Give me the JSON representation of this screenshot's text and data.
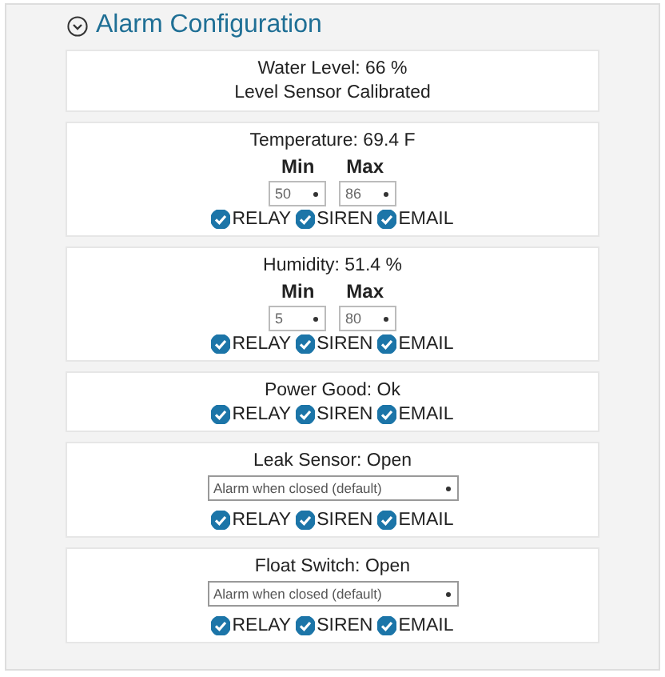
{
  "section": {
    "title": "Alarm Configuration",
    "expanded": true
  },
  "cards": [
    {
      "kind": "info",
      "lines": [
        "Water Level: 66 %",
        "Level Sensor Calibrated"
      ]
    },
    {
      "kind": "range",
      "lines": [
        "Temperature: 69.4 F"
      ],
      "min_label": "Min",
      "max_label": "Max",
      "min": "50",
      "max": "86",
      "options": [
        {
          "label": "RELAY",
          "checked": true
        },
        {
          "label": "SIREN",
          "checked": true
        },
        {
          "label": "EMAIL",
          "checked": true
        }
      ]
    },
    {
      "kind": "range",
      "lines": [
        "Humidity: 51.4 %"
      ],
      "min_label": "Min",
      "max_label": "Max",
      "min": "5",
      "max": "80",
      "options": [
        {
          "label": "RELAY",
          "checked": true
        },
        {
          "label": "SIREN",
          "checked": true
        },
        {
          "label": "EMAIL",
          "checked": true
        }
      ]
    },
    {
      "kind": "plain",
      "lines": [
        "Power Good: Ok"
      ],
      "options": [
        {
          "label": "RELAY",
          "checked": true
        },
        {
          "label": "SIREN",
          "checked": true
        },
        {
          "label": "EMAIL",
          "checked": true
        }
      ]
    },
    {
      "kind": "mode",
      "lines": [
        "Leak Sensor: Open"
      ],
      "mode": "Alarm when closed (default)",
      "options": [
        {
          "label": "RELAY",
          "checked": true
        },
        {
          "label": "SIREN",
          "checked": true
        },
        {
          "label": "EMAIL",
          "checked": true
        }
      ]
    },
    {
      "kind": "mode",
      "lines": [
        "Float Switch: Open"
      ],
      "mode": "Alarm when closed (default)",
      "options": [
        {
          "label": "RELAY",
          "checked": true
        },
        {
          "label": "SIREN",
          "checked": true
        },
        {
          "label": "EMAIL",
          "checked": true
        }
      ]
    }
  ]
}
